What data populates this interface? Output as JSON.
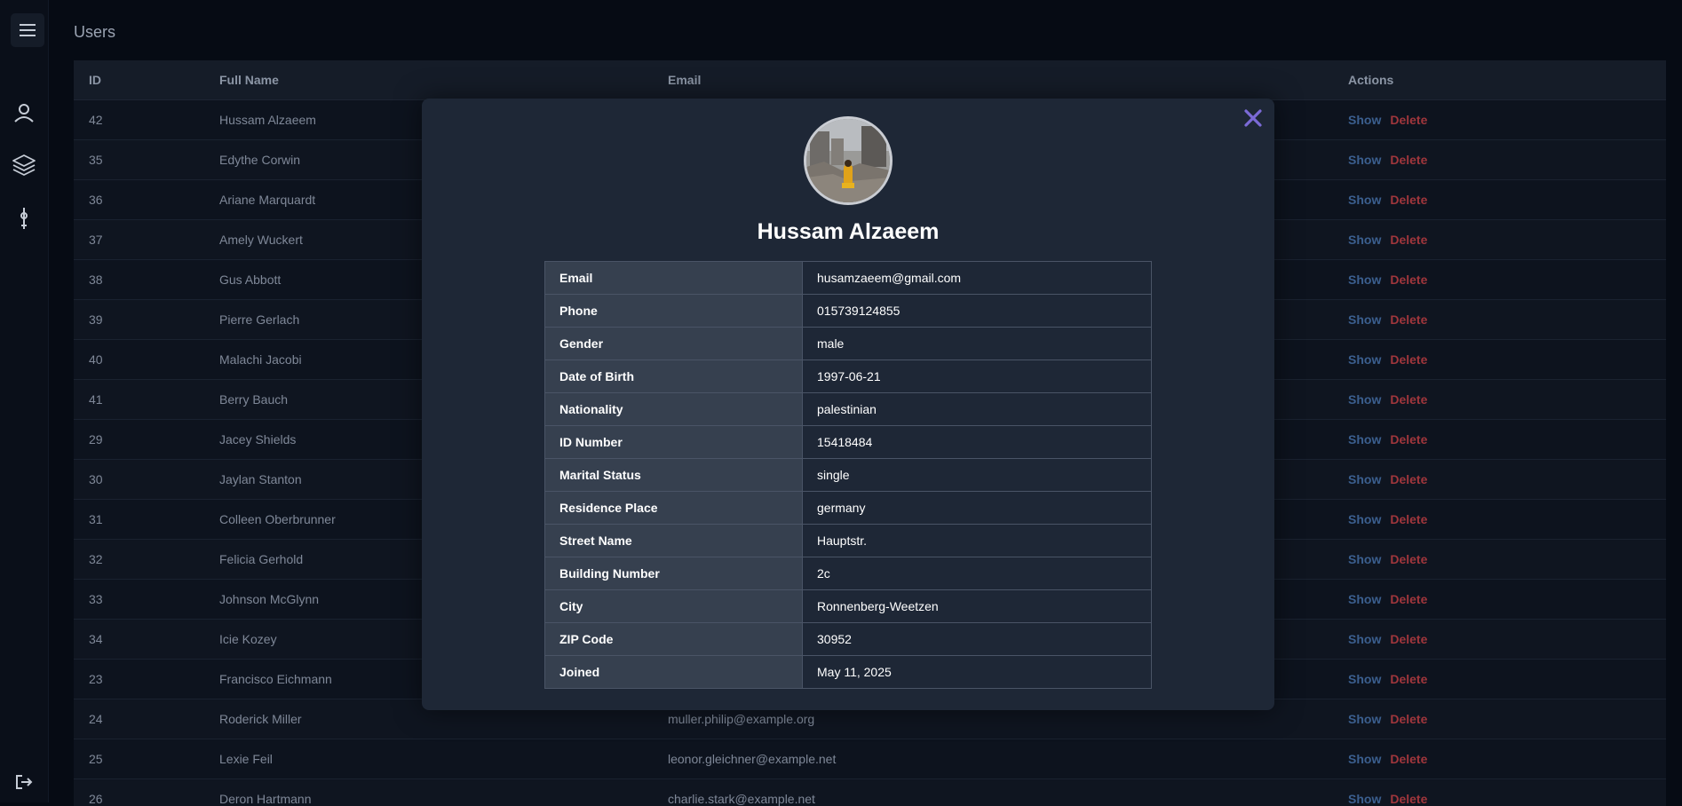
{
  "page": {
    "title": "Users"
  },
  "table": {
    "headers": {
      "id": "ID",
      "name": "Full Name",
      "email": "Email",
      "actions": "Actions"
    },
    "actions": {
      "show": "Show",
      "delete": "Delete"
    },
    "rows": [
      {
        "id": "42",
        "name": "Hussam Alzaeem",
        "email": ""
      },
      {
        "id": "35",
        "name": "Edythe Corwin",
        "email": ""
      },
      {
        "id": "36",
        "name": "Ariane Marquardt",
        "email": ""
      },
      {
        "id": "37",
        "name": "Amely Wuckert",
        "email": ""
      },
      {
        "id": "38",
        "name": "Gus Abbott",
        "email": ""
      },
      {
        "id": "39",
        "name": "Pierre Gerlach",
        "email": ""
      },
      {
        "id": "40",
        "name": "Malachi Jacobi",
        "email": ""
      },
      {
        "id": "41",
        "name": "Berry Bauch",
        "email": ""
      },
      {
        "id": "29",
        "name": "Jacey Shields",
        "email": ""
      },
      {
        "id": "30",
        "name": "Jaylan Stanton",
        "email": ""
      },
      {
        "id": "31",
        "name": "Colleen Oberbrunner",
        "email": ""
      },
      {
        "id": "32",
        "name": "Felicia Gerhold",
        "email": ""
      },
      {
        "id": "33",
        "name": "Johnson McGlynn",
        "email": ""
      },
      {
        "id": "34",
        "name": "Icie Kozey",
        "email": ""
      },
      {
        "id": "23",
        "name": "Francisco Eichmann",
        "email": ""
      },
      {
        "id": "24",
        "name": "Roderick Miller",
        "email": "muller.philip@example.org"
      },
      {
        "id": "25",
        "name": "Lexie Feil",
        "email": "leonor.gleichner@example.net"
      },
      {
        "id": "26",
        "name": "Deron Hartmann",
        "email": "charlie.stark@example.net"
      }
    ]
  },
  "modal": {
    "name": "Hussam Alzaeem",
    "details": [
      {
        "label": "Email",
        "value": "husamzaeem@gmail.com"
      },
      {
        "label": "Phone",
        "value": "015739124855"
      },
      {
        "label": "Gender",
        "value": "male"
      },
      {
        "label": "Date of Birth",
        "value": "1997-06-21"
      },
      {
        "label": "Nationality",
        "value": "palestinian"
      },
      {
        "label": "ID Number",
        "value": "15418484"
      },
      {
        "label": "Marital Status",
        "value": "single"
      },
      {
        "label": "Residence Place",
        "value": "germany"
      },
      {
        "label": "Street Name",
        "value": "Hauptstr."
      },
      {
        "label": "Building Number",
        "value": "2c"
      },
      {
        "label": "City",
        "value": "Ronnenberg-Weetzen"
      },
      {
        "label": "ZIP Code",
        "value": "30952"
      },
      {
        "label": "Joined",
        "value": "May 11, 2025"
      }
    ]
  },
  "icons": {
    "menu": "hamburger-menu-icon",
    "users": "user-icon",
    "layers": "layers-icon",
    "tool": "tool-icon",
    "logout": "logout-icon",
    "close": "close-icon"
  },
  "colors": {
    "background": "#060b14",
    "modal": "#1e2736",
    "show": "#3b5f8f",
    "delete": "#a0363c",
    "close": "#7b6ad6"
  }
}
